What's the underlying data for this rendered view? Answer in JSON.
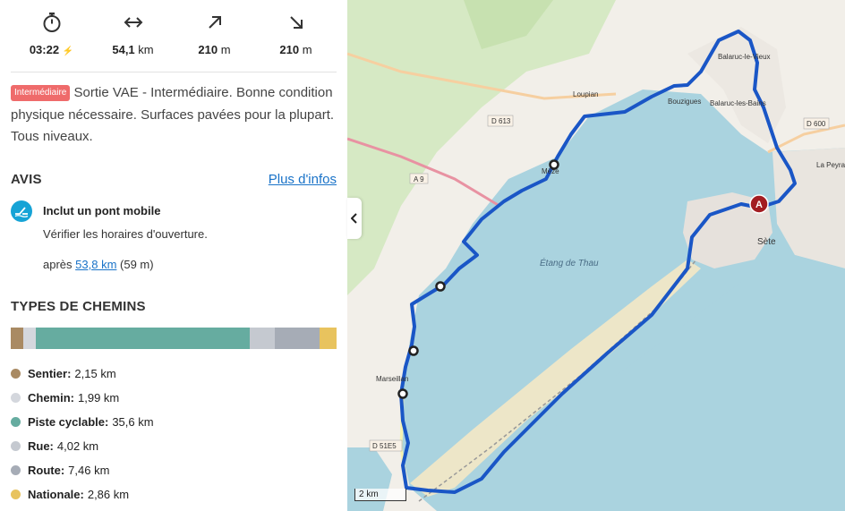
{
  "stats": {
    "duration": "03:22",
    "distance_value": "54,1",
    "distance_unit": "km",
    "ascent_value": "210",
    "ascent_unit": "m",
    "descent_value": "210",
    "descent_unit": "m"
  },
  "description": {
    "badge": "Intermédiaire",
    "text": "Sortie VAE - Intermédiaire. Bonne condition physique nécessaire. Surfaces pavées pour la plupart. Tous niveaux."
  },
  "avis": {
    "heading": "AVIS",
    "more_link": "Plus d'infos",
    "notice_title": "Inclut un pont mobile",
    "notice_sub": "Vérifier les horaires d'ouverture.",
    "after_prefix": "après",
    "after_link": "53,8 km",
    "after_suffix": "(59 m)"
  },
  "paths": {
    "heading": "TYPES DE CHEMINS",
    "items": [
      {
        "label": "Sentier:",
        "value": "2,15 km",
        "color": "#a98a63",
        "km": 2.15
      },
      {
        "label": "Chemin:",
        "value": "1,99 km",
        "color": "#d4d7dd",
        "km": 1.99
      },
      {
        "label": "Piste cyclable:",
        "value": "35,6 km",
        "color": "#66aca0",
        "km": 35.6
      },
      {
        "label": "Rue:",
        "value": "4,02 km",
        "color": "#c5c9d0",
        "km": 4.02
      },
      {
        "label": "Route:",
        "value": "7,46 km",
        "color": "#a6acb6",
        "km": 7.46
      },
      {
        "label": "Nationale:",
        "value": "2,86 km",
        "color": "#e8c35e",
        "km": 2.86
      }
    ]
  },
  "map": {
    "labels": {
      "loupian": "Loupian",
      "bouzigues": "Bouzigues",
      "balaruc_vieux": "Balaruc-le-Vieux",
      "balaruc_bains": "Balaruc-les-Bains",
      "meze": "Mèze",
      "sete": "Sète",
      "la_peyrade": "La Peyra",
      "etang": "Étang de Thau",
      "marseillan": "Marseillan",
      "d613": "D 613",
      "a9": "A 9",
      "d600": "D 600",
      "d51e5": "D 51E5"
    },
    "start_marker": "A",
    "scale": "2 km",
    "route_color": "#1a56c6"
  }
}
